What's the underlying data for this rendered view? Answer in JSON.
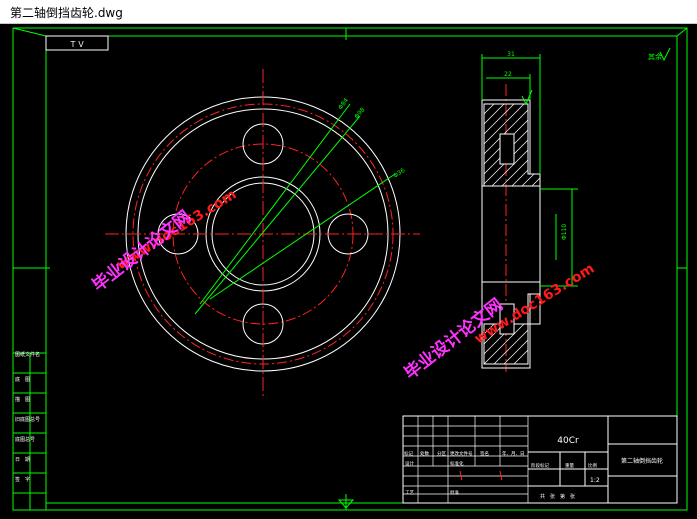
{
  "window": {
    "title": "第二轴倒挡齿轮.dwg"
  },
  "colors": {
    "background": "#000000",
    "frame": "#00ff00",
    "geometry": "#ffffff",
    "centerline": "#ff0000",
    "dimension": "#00ff00",
    "pitch_circle": "#ff0000",
    "hatch": "#ffffff",
    "watermark_red": "#ff1a1a",
    "watermark_magenta": "#ff33ff"
  },
  "sheet": {
    "code_box": "ＴＶ",
    "roughness_mark": "其余"
  },
  "left_bar": {
    "items": [
      "图纸文件名",
      "底　图",
      "描　图",
      "旧底图总号",
      "底图总号",
      "日　期",
      "签　字"
    ]
  },
  "title_block": {
    "material": "40Cr",
    "part_name": "第二轴倒挡齿轮",
    "scale": "1:2",
    "headers": [
      "标记",
      "处数",
      "分区",
      "更改文件号",
      "签名",
      "年、月、日"
    ],
    "stage_label": "阶段标记",
    "weight_label": "重量",
    "scale_label": "比例",
    "design_label": "设计",
    "std_label": "标准化",
    "process_label": "工艺",
    "approve_label": "批准",
    "sheet_info": "共　张　第　张"
  },
  "dimensions": {
    "width_31": "31",
    "width_22": "22",
    "leader_1": "Φ84",
    "leader_2": "Φ98",
    "leader_3": "Φ36",
    "side_dim": "Φ110"
  },
  "watermarks": {
    "site": "www.doc163.com",
    "name": "毕业设计论文网"
  }
}
